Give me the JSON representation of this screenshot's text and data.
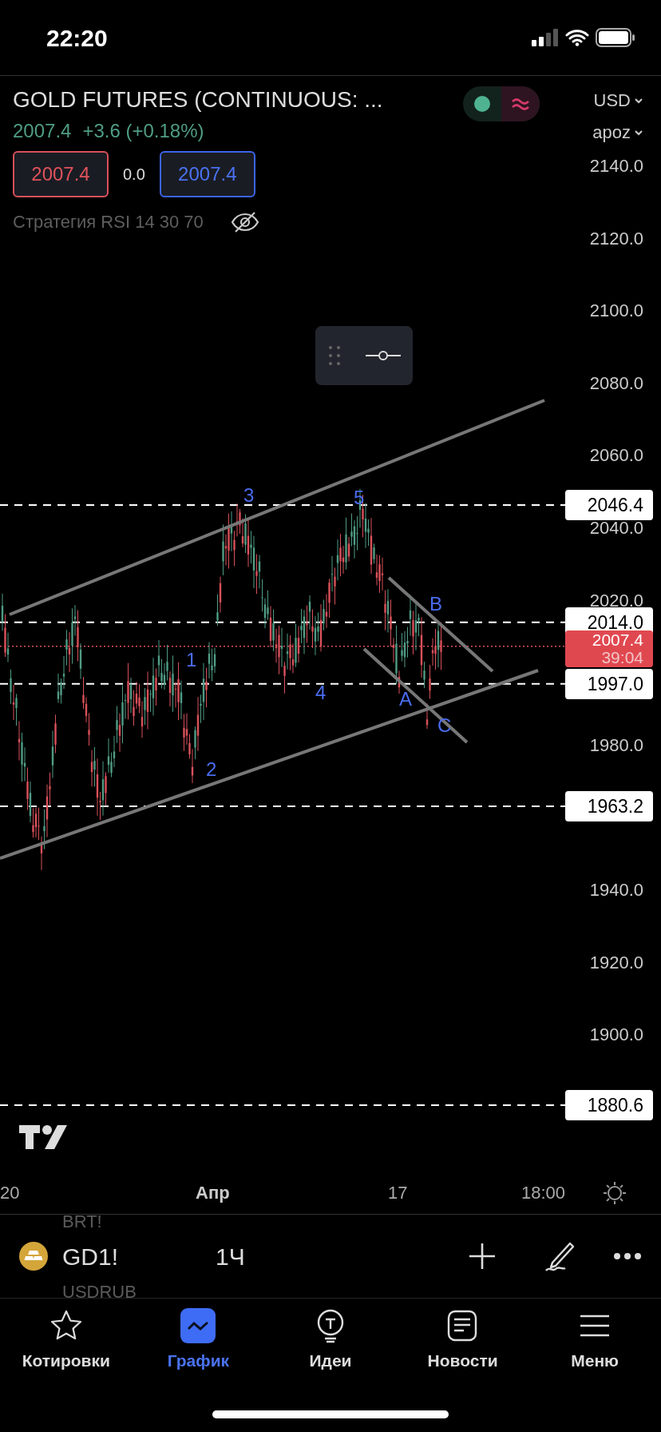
{
  "status_bar": {
    "time": "22:20"
  },
  "header": {
    "title": "GOLD FUTURES (CONTINUOUS: ...",
    "price": "2007.4",
    "change": "+3.6 (+0.18%)",
    "bid": "2007.4",
    "spread": "0.0",
    "ask": "2007.4",
    "strategy": "Стратегия RSI 14 30 70",
    "currency": "USD",
    "account": "apoz",
    "market_open": true
  },
  "price_axis": [
    "2140.0",
    "2120.0",
    "2100.0",
    "2080.0",
    "2060.0",
    "2040.0",
    "2020.0",
    "1980.0",
    "1940.0",
    "1920.0",
    "1900.0"
  ],
  "levels": [
    "2046.4",
    "2014.0",
    "1997.0",
    "1963.2",
    "1880.6"
  ],
  "current": {
    "price": "2007.4",
    "countdown": "39:04"
  },
  "wave_labels": [
    "3",
    "5",
    "1",
    "2",
    "4",
    "A",
    "B",
    "C"
  ],
  "time_axis": [
    {
      "label": "20",
      "kind": "day"
    },
    {
      "label": "Апр",
      "kind": "month"
    },
    {
      "label": "17",
      "kind": "day"
    },
    {
      "label": "18:00",
      "kind": "time"
    }
  ],
  "toolbar": {
    "symbol": "GD1!",
    "interval": "1Ч",
    "behind": [
      "BRT!",
      "USDRUB"
    ]
  },
  "tabs": [
    {
      "label": "Котировки",
      "selected": false
    },
    {
      "label": "График",
      "selected": true
    },
    {
      "label": "Идеи",
      "selected": false
    },
    {
      "label": "Новости",
      "selected": false
    },
    {
      "label": "Меню",
      "selected": false
    }
  ]
}
